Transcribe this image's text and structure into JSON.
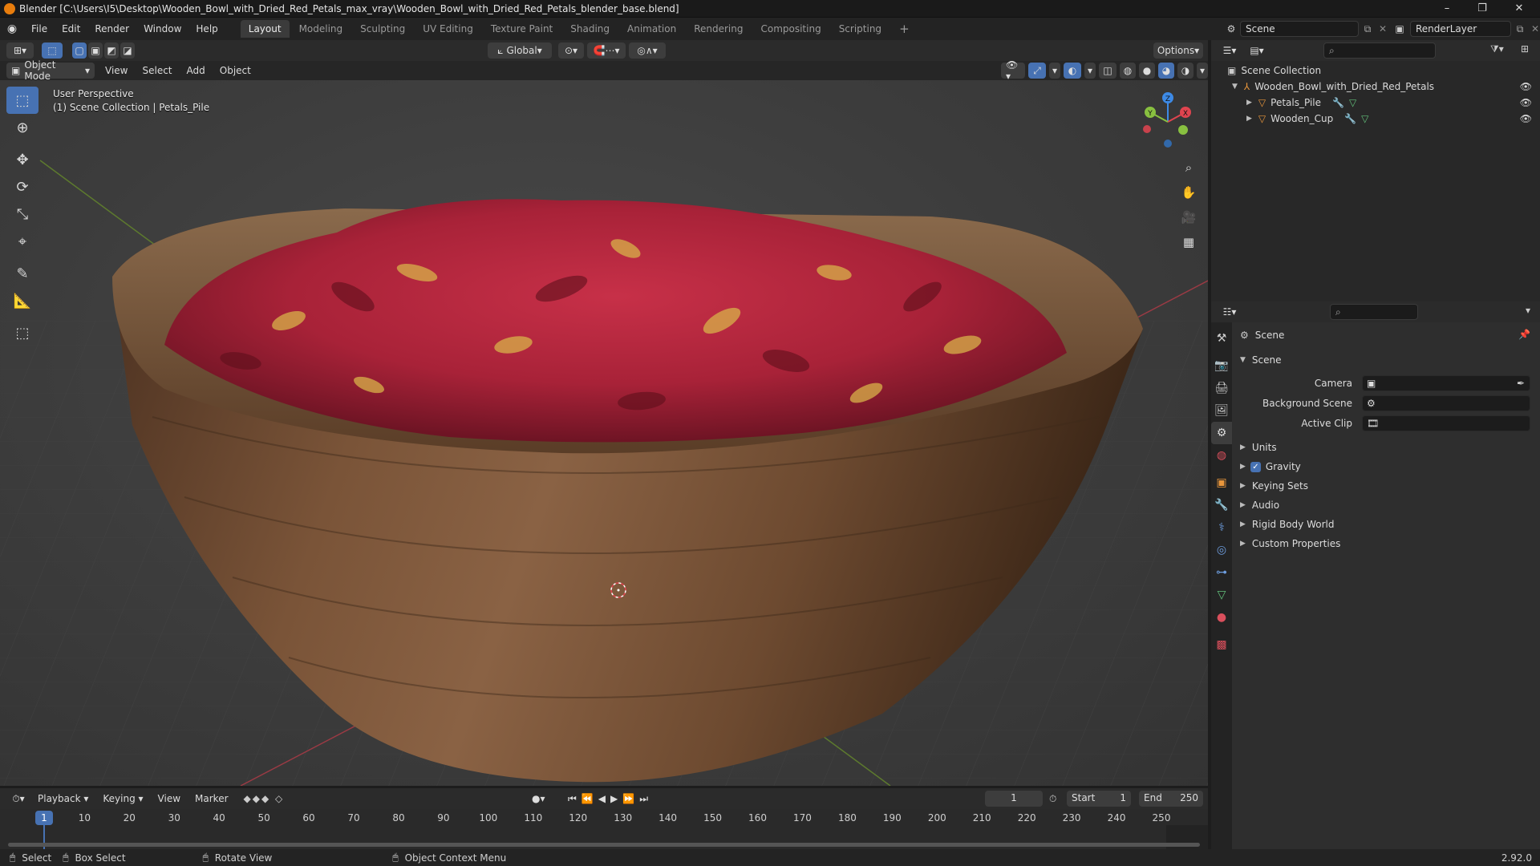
{
  "window": {
    "title": "Blender [C:\\Users\\I5\\Desktop\\Wooden_Bowl_with_Dried_Red_Petals_max_vray\\Wooden_Bowl_with_Dried_Red_Petals_blender_base.blend]",
    "minimize": "–",
    "maximize": "❐",
    "close": "✕"
  },
  "menubar": {
    "menus": [
      "File",
      "Edit",
      "Render",
      "Window",
      "Help"
    ],
    "workspaces": [
      "Layout",
      "Modeling",
      "Sculpting",
      "UV Editing",
      "Texture Paint",
      "Shading",
      "Animation",
      "Rendering",
      "Compositing",
      "Scripting"
    ],
    "active_workspace": "Layout",
    "add_workspace": "+",
    "scene": "Scene",
    "view_layer": "RenderLayer"
  },
  "viewport_header": {
    "mode": "Object Mode",
    "menus": [
      "View",
      "Select",
      "Add",
      "Object"
    ],
    "transform_orientation": "Global",
    "options": "Options"
  },
  "viewport": {
    "perspective": "User Perspective",
    "collection_info": "(1) Scene Collection | Petals_Pile",
    "gizmo": {
      "x": "X",
      "y": "Y",
      "z": "Z"
    }
  },
  "toolbar": {
    "tools": [
      "select-box",
      "cursor",
      "move",
      "rotate",
      "scale",
      "transform",
      "annotate",
      "measure",
      "add-cube"
    ]
  },
  "outliner": {
    "root": "Scene Collection",
    "collection": "Wooden_Bowl_with_Dried_Red_Petals",
    "objects": [
      "Petals_Pile",
      "Wooden_Cup"
    ]
  },
  "properties": {
    "breadcrumb": "Scene",
    "panel_title": "Scene",
    "fields": [
      {
        "label": "Camera"
      },
      {
        "label": "Background Scene"
      },
      {
        "label": "Active Clip"
      }
    ],
    "subpanels": [
      {
        "label": "Units",
        "checkbox": false
      },
      {
        "label": "Gravity",
        "checkbox": true
      },
      {
        "label": "Keying Sets",
        "checkbox": false
      },
      {
        "label": "Audio",
        "checkbox": false
      },
      {
        "label": "Rigid Body World",
        "checkbox": false
      },
      {
        "label": "Custom Properties",
        "checkbox": false
      }
    ]
  },
  "timeline": {
    "menus": [
      "Playback",
      "Keying",
      "View",
      "Marker"
    ],
    "current_frame": "1",
    "start_label": "Start",
    "start": "1",
    "end_label": "End",
    "end": "250",
    "ticks": [
      "1",
      "10",
      "20",
      "30",
      "40",
      "50",
      "60",
      "70",
      "80",
      "90",
      "100",
      "110",
      "120",
      "130",
      "140",
      "150",
      "160",
      "170",
      "180",
      "190",
      "200",
      "210",
      "220",
      "230",
      "240",
      "250"
    ]
  },
  "statusbar": {
    "select": "Select",
    "box_select": "Box Select",
    "rotate_view": "Rotate View",
    "context_menu": "Object Context Menu",
    "version": "2.92.0"
  },
  "colors": {
    "accent": "#4772b3",
    "x_axis": "#e0444f",
    "y_axis": "#88c040",
    "z_axis": "#3d8ae6",
    "petal_red": "#b8263a",
    "wood": "#7a5235"
  }
}
